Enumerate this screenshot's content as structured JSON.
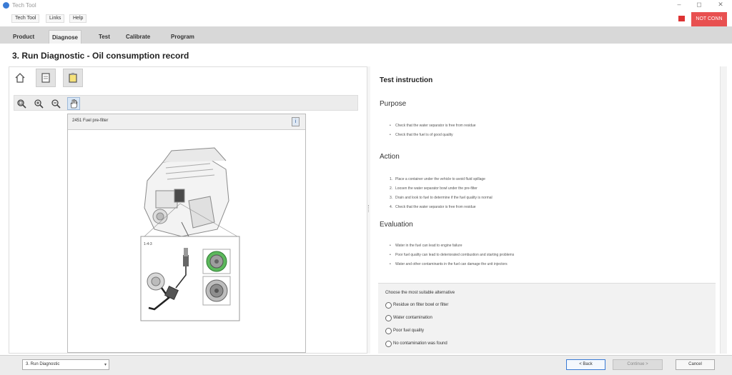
{
  "window": {
    "title": "Tech Tool",
    "controls": {
      "minimize": "–",
      "maximize": "◻",
      "close": "✕"
    }
  },
  "menubar": {
    "items": [
      "Tech Tool",
      "Links",
      "Help"
    ],
    "status_label": "NOT CONN",
    "status_color": "#e85050"
  },
  "tabs": [
    "Product",
    "Diagnose",
    "Test",
    "Calibrate",
    "Program"
  ],
  "active_tab": "Diagnose",
  "page_title": "3. Run Diagnostic - Oil consumption record",
  "left_toolbar": {
    "icons": [
      "home-icon",
      "document-icon",
      "notes-icon"
    ]
  },
  "zoom_toolbar": {
    "icons": [
      "zoom-fit-icon",
      "zoom-in-icon",
      "zoom-out-icon",
      "pan-hand-icon"
    ]
  },
  "image_panel": {
    "title": "2451 Fuel pre-filter",
    "info_label": "i",
    "detail_label": "1-4-3"
  },
  "instructions": {
    "title": "Test instruction",
    "purpose_heading": "Purpose",
    "purpose_items": [
      "Check that the water separator is free from residue",
      "Check that the fuel is of good quality"
    ],
    "action_heading": "Action",
    "action_items": [
      "Place a container under the vehicle to avoid fluid spillage",
      "Loosen the water separator bowl under the pre-filter",
      "Drain and look to fuel to determine if the fuel quality is normal",
      "Check that the water separator is free from residue"
    ],
    "evaluation_heading": "Evaluation",
    "evaluation_items": [
      "Water in the fuel can lead to engine failure",
      "Poor fuel quality can lead to deteriorated combustion and starting problems",
      "Water and other contaminants in the fuel can damage the unit injectors"
    ]
  },
  "choice": {
    "prompt": "Choose the most suitable alternative",
    "options": [
      "Residue on filter bowl or filter",
      "Water contamination",
      "Poor fuel quality",
      "No contamination was found"
    ]
  },
  "bottom_bar": {
    "step_select": "3. Run Diagnostic",
    "back_label": "< Back",
    "continue_label": "Continue >",
    "cancel_label": "Cancel"
  }
}
